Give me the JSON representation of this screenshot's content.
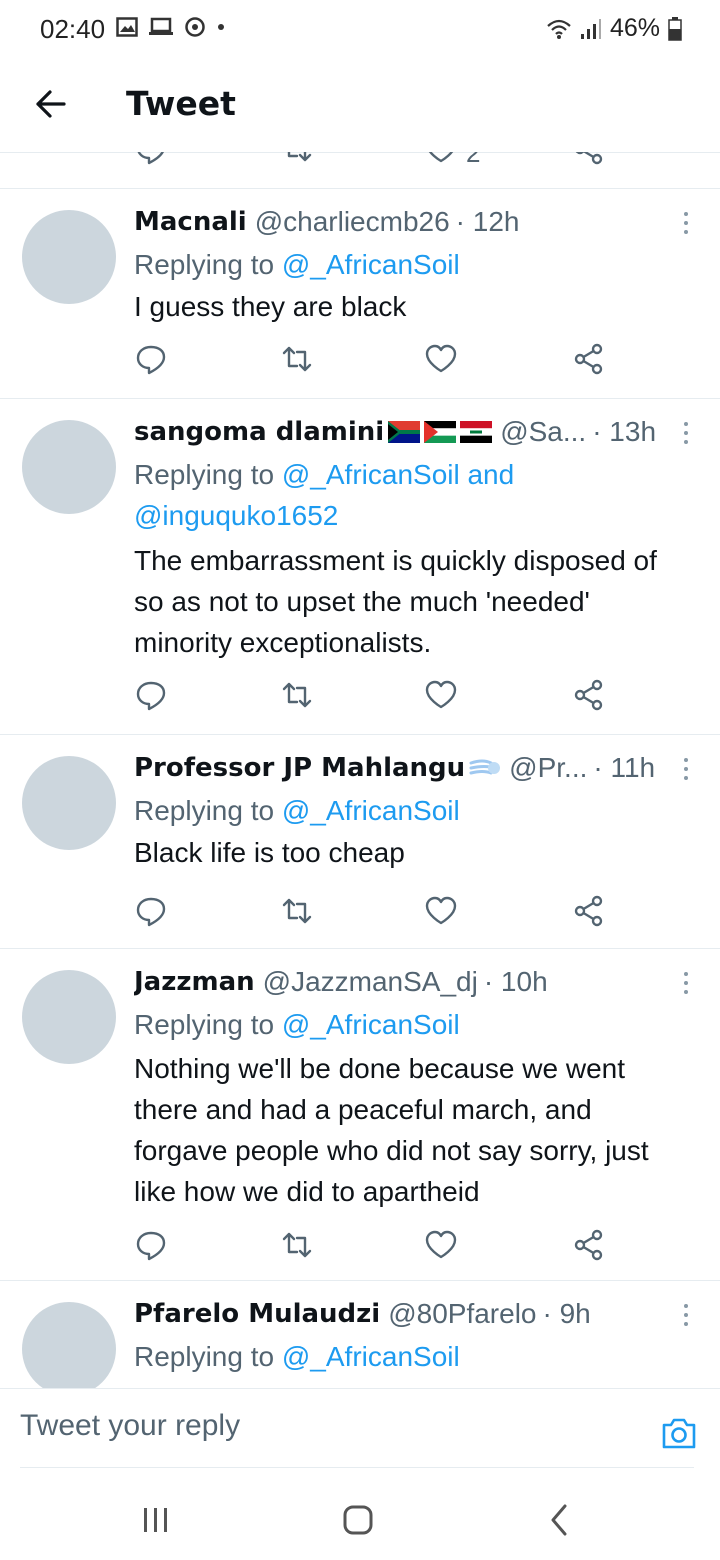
{
  "status_bar": {
    "time": "02:40",
    "battery": "46%"
  },
  "header": {
    "title": "Tweet"
  },
  "prev_tweet_tail": {
    "like_count": "2"
  },
  "tweets": [
    {
      "name": "Macnali",
      "handle": "@charliecmb26",
      "time": "· 12h",
      "replying_label": "Replying to",
      "replying_to": "@_AfricanSoil",
      "replying_extra": "",
      "text": "I guess they are black"
    },
    {
      "name": "sangoma dlamini",
      "flags": [
        "south-africa-flag",
        "palestine-flag",
        "iraq-flag"
      ],
      "handle": "@Sa...",
      "time": "· 13h",
      "replying_label": "Replying to",
      "replying_to": "@_AfricanSoil and",
      "replying_extra": "@inguquko1652",
      "text": "The embarrassment is quickly disposed of so as not to upset the much 'needed' minority exceptionalists."
    },
    {
      "name": "Professor JP Mahlangu",
      "emoji": "dash-emoji",
      "handle": "@Pr...",
      "time": "· 11h",
      "replying_label": "Replying to",
      "replying_to": "@_AfricanSoil",
      "replying_extra": "",
      "text": "Black life is too cheap"
    },
    {
      "name": "Jazzman",
      "handle": "@JazzmanSA_dj",
      "time": "· 10h",
      "replying_label": "Replying to",
      "replying_to": "@_AfricanSoil",
      "replying_extra": "",
      "text": "Nothing we'll be done because we went there and had a peaceful march, and forgave people who did not say sorry, just like how we did to apartheid"
    },
    {
      "name": "Pfarelo Mulaudzi",
      "handle": "@80Pfarelo",
      "time": "· 9h",
      "replying_label": "Replying to",
      "replying_to": "@_AfricanSoil",
      "replying_extra": "",
      "text": ""
    }
  ],
  "composer": {
    "placeholder": "Tweet your reply"
  },
  "colors": {
    "link": "#1d9bf0",
    "secondary": "#536471",
    "avatar": "#ccd6dd",
    "divider": "#e6ecf0"
  }
}
